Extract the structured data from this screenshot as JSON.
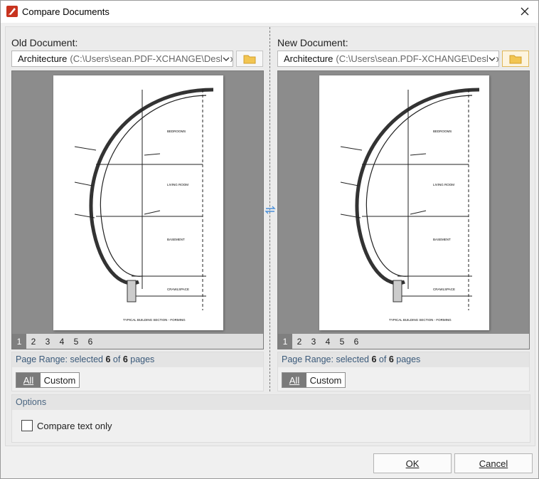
{
  "window": {
    "title": "Compare Documents"
  },
  "old_doc": {
    "label": "Old Document:",
    "file_name": "Architecture",
    "file_path": "(C:\\Users\\sean.PDF-XCHANGE\\Desktop",
    "pages": [
      "1",
      "2",
      "3",
      "4",
      "5",
      "6"
    ],
    "selected_page": "1",
    "range_prefix": "Page Range: selected ",
    "range_selected": "6",
    "range_mid": " of ",
    "range_total": "6",
    "range_suffix": " pages",
    "range_all": "All",
    "range_custom": "Custom",
    "range_mode": "All"
  },
  "new_doc": {
    "label": "New Document:",
    "file_name": "Architecture",
    "file_path": "(C:\\Users\\sean.PDF-XCHANGE\\Desktop",
    "pages": [
      "1",
      "2",
      "3",
      "4",
      "5",
      "6"
    ],
    "selected_page": "1",
    "range_prefix": "Page Range: selected ",
    "range_selected": "6",
    "range_mid": " of ",
    "range_total": "6",
    "range_suffix": " pages",
    "range_all": "All",
    "range_custom": "Custom",
    "range_mode": "All"
  },
  "drawing": {
    "labels": [
      "BEDROOMS",
      "LIVING ROOM",
      "BASEMENT",
      "CRAWLSPACE"
    ],
    "caption": "TYPICAL BUILDING SECTION - FORMING"
  },
  "options": {
    "heading": "Options",
    "compare_text_only": "Compare text only",
    "compare_text_only_checked": false
  },
  "buttons": {
    "ok": "OK",
    "cancel": "Cancel"
  },
  "colors": {
    "accent_folder": "#e7b84a",
    "pdf_icon": "#c8331f",
    "selected_page_bg": "#7f7f7f"
  }
}
